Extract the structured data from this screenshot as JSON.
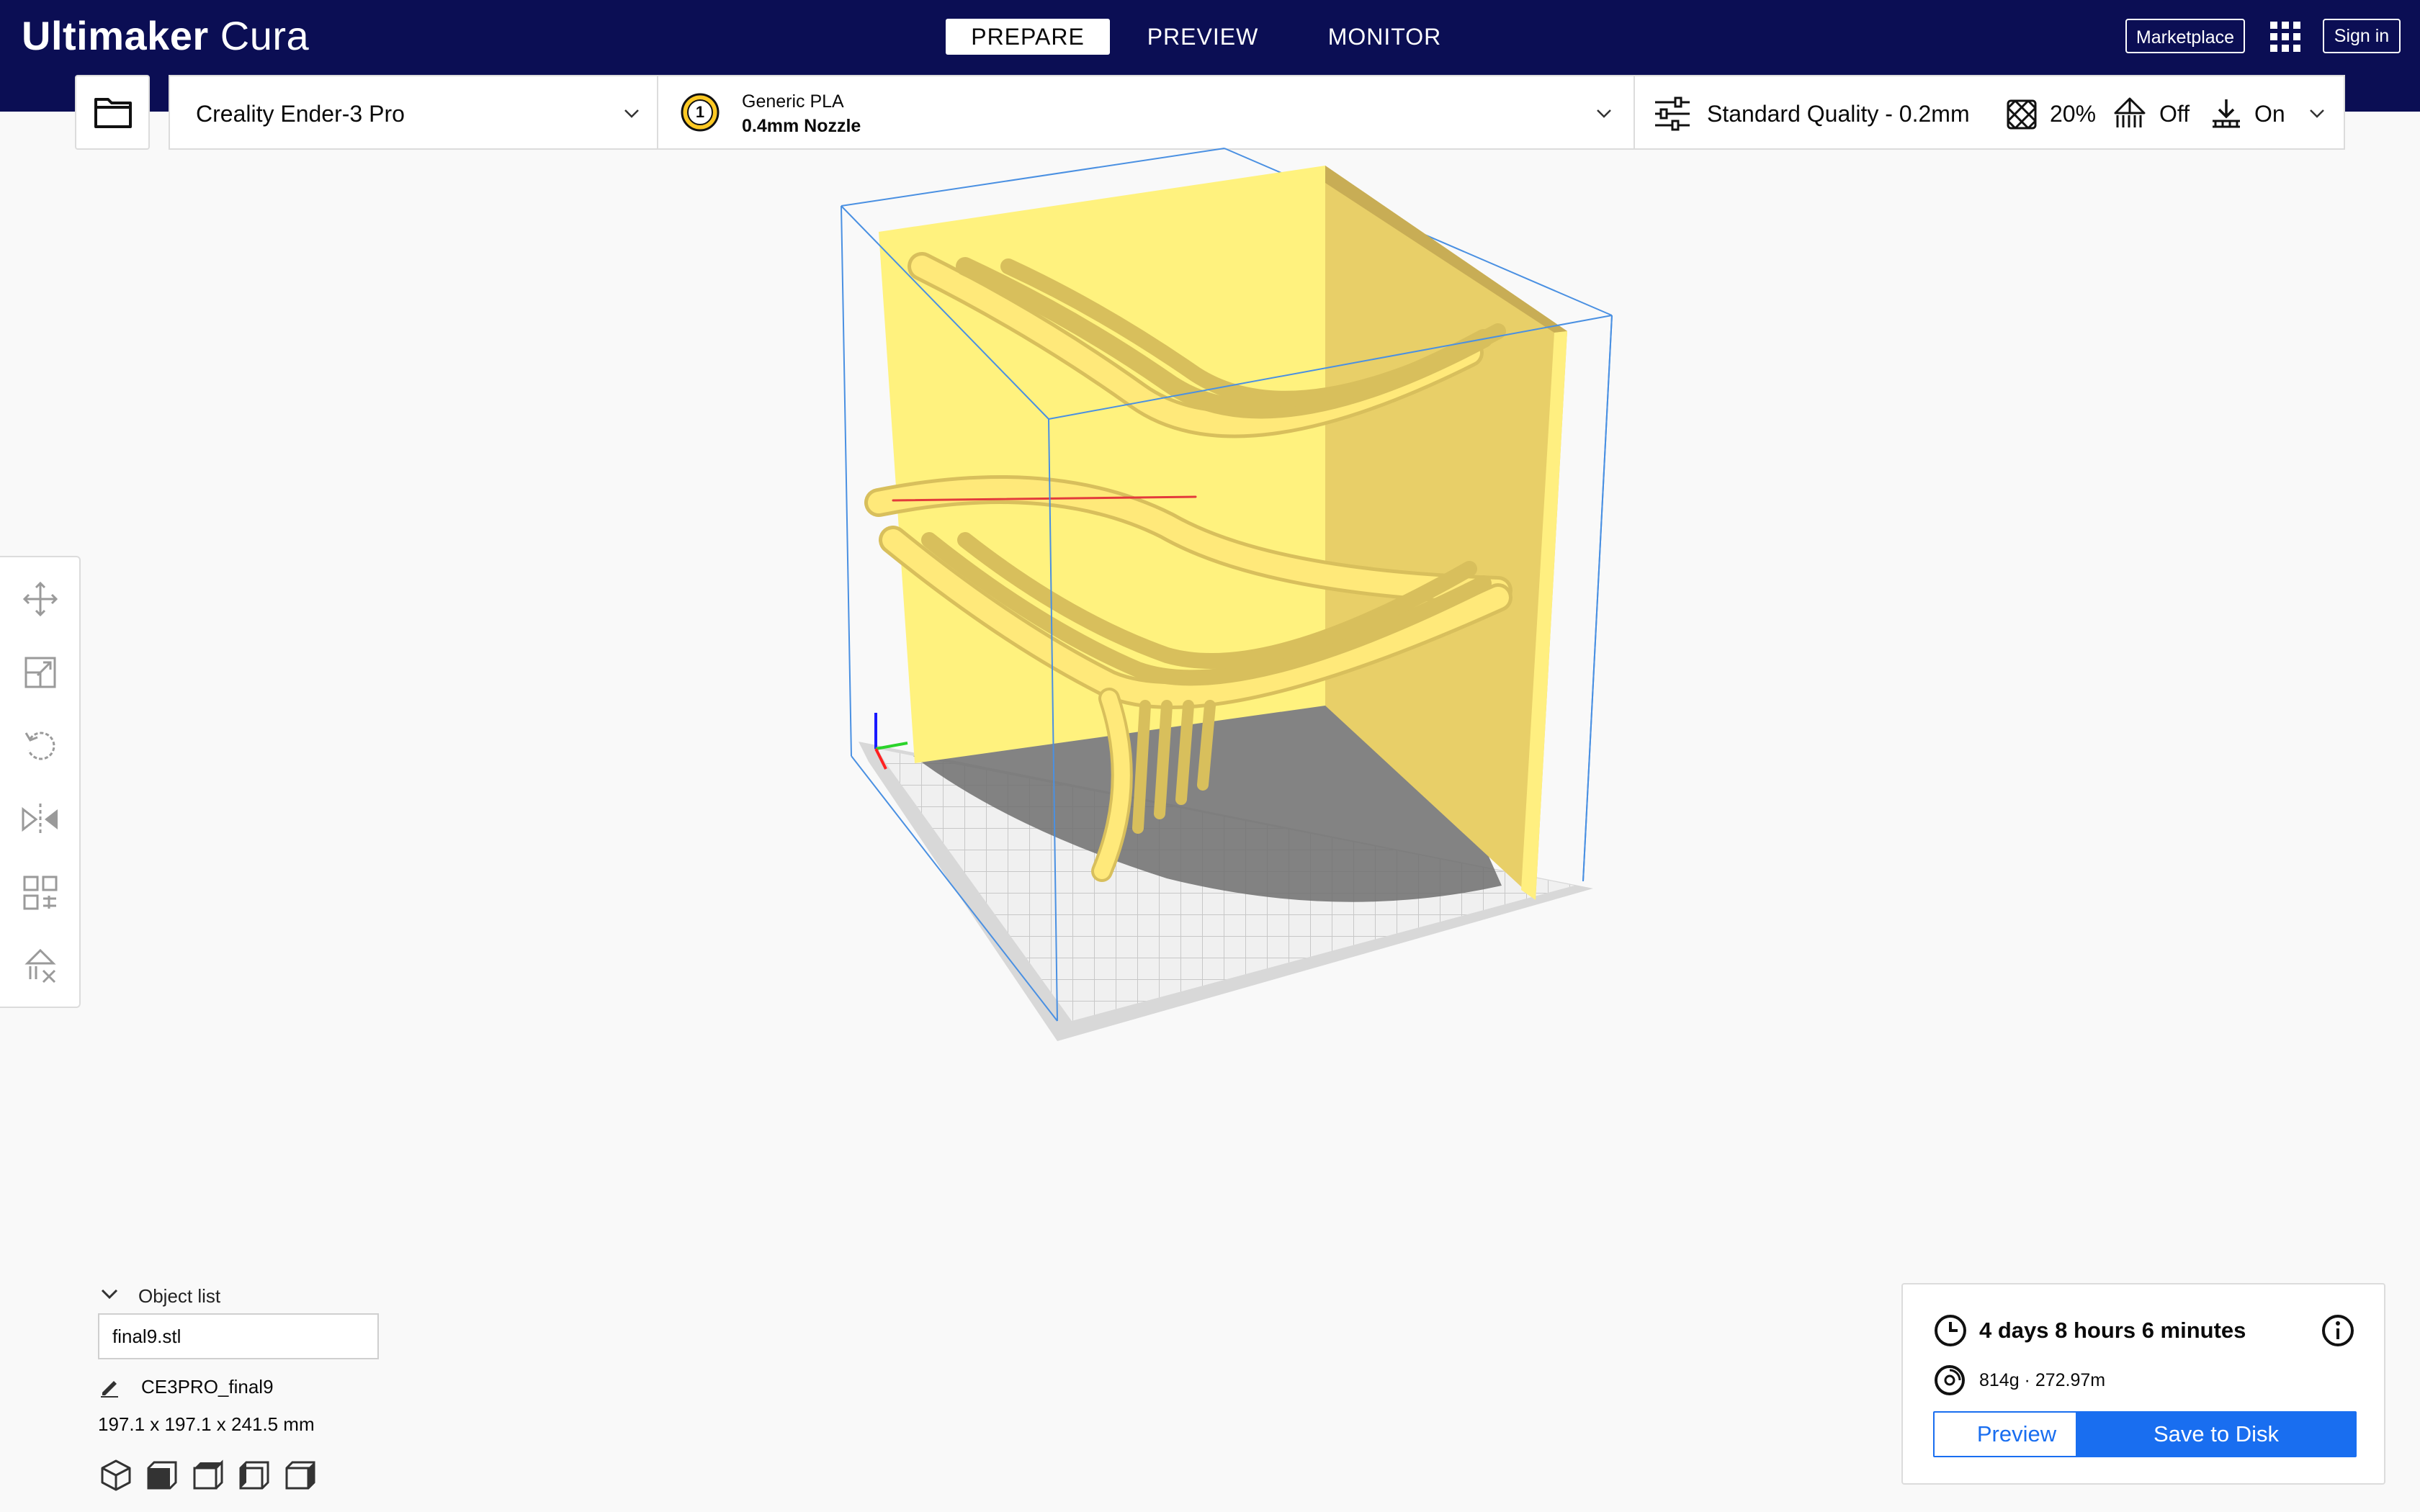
{
  "header": {
    "brand": "Ultimaker",
    "product": "Cura",
    "tabs": [
      {
        "label": "PREPARE",
        "active": true
      },
      {
        "label": "PREVIEW",
        "active": false
      },
      {
        "label": "MONITOR",
        "active": false
      }
    ],
    "marketplace_label": "Marketplace",
    "signin_label": "Sign in"
  },
  "toolbar": {
    "printer": "Creality Ender-3 Pro",
    "extruder_number": "1",
    "material": "Generic PLA",
    "nozzle": "0.4mm Nozzle",
    "quality": "Standard Quality - 0.2mm",
    "infill": "20%",
    "support": "Off",
    "adhesion": "On"
  },
  "tools": [
    "move-icon",
    "scale-icon",
    "rotate-icon",
    "mirror-icon",
    "per-model-settings-icon",
    "support-blocker-icon"
  ],
  "object_list": {
    "label": "Object list",
    "items": [
      "final9.stl"
    ],
    "job_name": "CE3PRO_final9",
    "dimensions": "197.1 x 197.1 x 241.5 mm"
  },
  "view_buttons": [
    "3d-view-icon",
    "front-view-icon",
    "top-view-icon",
    "left-view-icon",
    "right-view-icon"
  ],
  "print_info": {
    "time": "4 days 8 hours 6 minutes",
    "material_usage": "814g · 272.97m",
    "preview_label": "Preview",
    "save_label": "Save to Disk"
  },
  "colors": {
    "header_bg": "#0b0e54",
    "accent_blue": "#196ef0",
    "model_yellow": "#ffef80",
    "build_volume_line": "#4a90e2"
  }
}
